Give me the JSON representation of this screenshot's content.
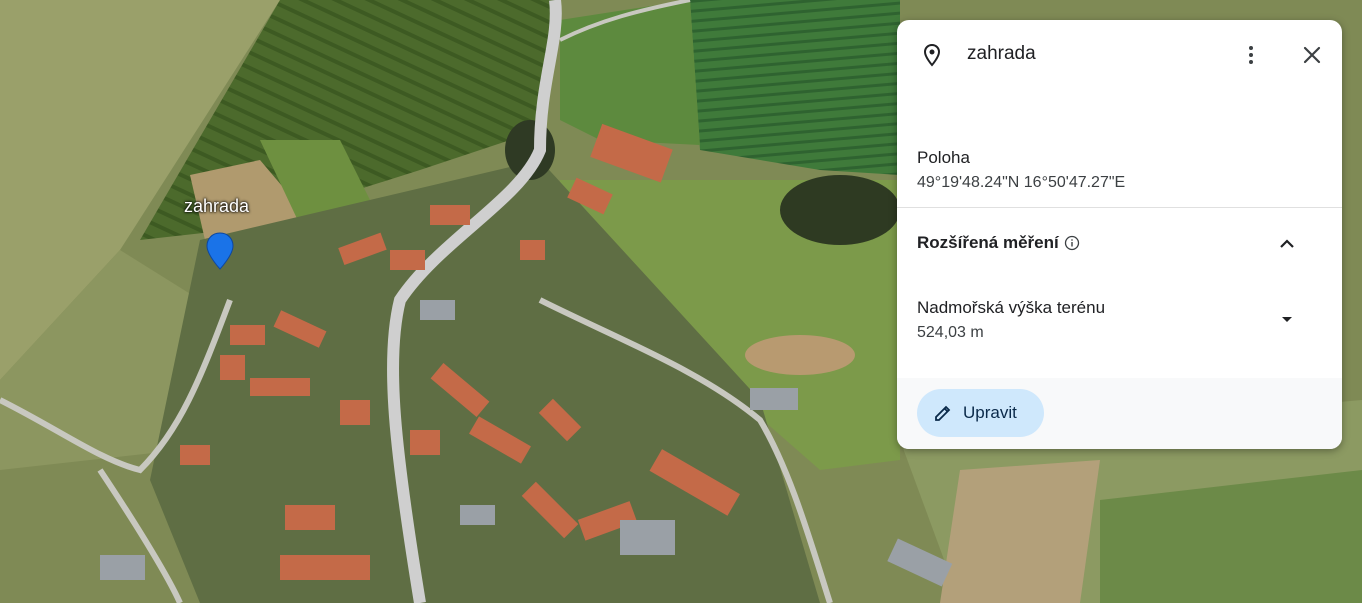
{
  "map": {
    "placemark_label": "zahrada",
    "placemark_icon": "location-pin-icon",
    "pin_color": "#1a73e8"
  },
  "panel": {
    "title": "zahrada",
    "title_icon": "location-outline-icon",
    "more_icon": "more-vert-icon",
    "close_icon": "close-icon",
    "location": {
      "label": "Poloha",
      "value": "49°19'48.24\"N 16°50'47.27\"E"
    },
    "advanced": {
      "label": "Rozšířená měření",
      "info_icon": "info-icon",
      "toggle_icon": "chevron-up-icon"
    },
    "elevation": {
      "label": "Nadmořská výška terénu",
      "value": "524,03 m",
      "dropdown_icon": "arrow-drop-down-icon"
    },
    "edit_button": {
      "label": "Upravit",
      "icon": "pencil-icon",
      "bg_color": "#cfe8fc"
    }
  }
}
